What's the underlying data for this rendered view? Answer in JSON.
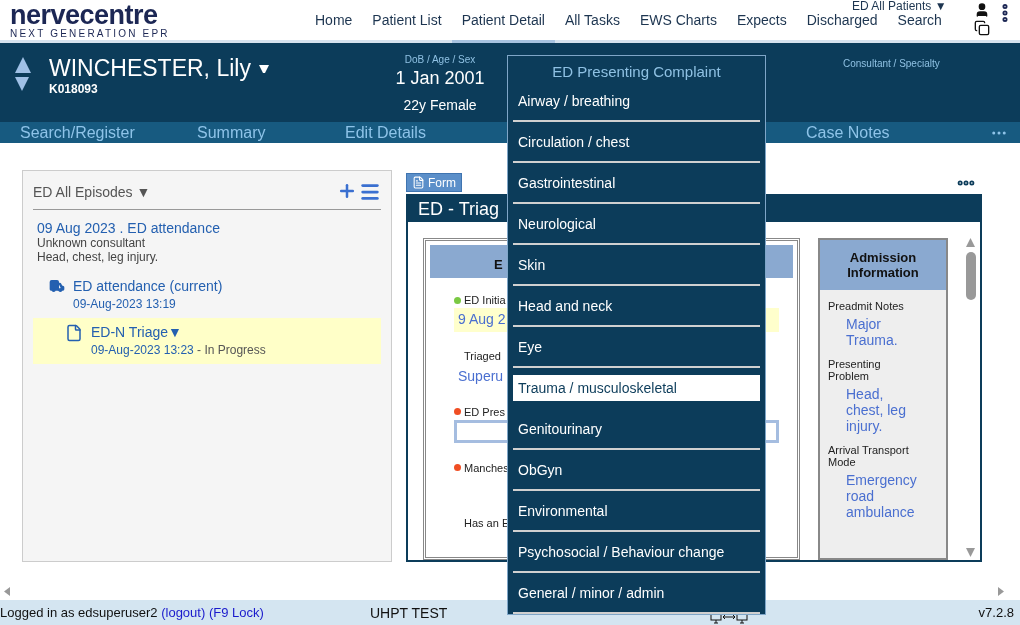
{
  "logo": {
    "name": "nervecentre",
    "tagline": "NEXT GENERATION EPR"
  },
  "nav": [
    {
      "label": "Home",
      "selected": false
    },
    {
      "label": "Patient List",
      "selected": false
    },
    {
      "label": "Patient Detail",
      "selected": true
    },
    {
      "label": "All Tasks",
      "selected": false
    },
    {
      "label": "EWS Charts",
      "selected": false
    },
    {
      "label": "Expects",
      "selected": false
    },
    {
      "label": "Discharged",
      "selected": false
    },
    {
      "label": "Search",
      "selected": false
    }
  ],
  "patient_list_selector": "ED All Patients ▼",
  "patient": {
    "name": "WINCHESTER, Lily",
    "id": "K018093",
    "dob_label": "DoB / Age / Sex",
    "dob": "1 Jan 2001",
    "age_sex": "22y Female",
    "consultant_label": "Consultant / Specialty"
  },
  "subnav": [
    "Search/Register",
    "Summary",
    "Edit Details",
    "Case Notes"
  ],
  "episodes": {
    "title": "ED All Episodes ▼",
    "episode": {
      "title": "09 Aug 2023 . ED attendance",
      "consultant": "Unknown consultant",
      "complaint": "Head, chest, leg injury.",
      "items": [
        {
          "kind": "attendance",
          "title": "ED attendance (current)",
          "time": "09-Aug-2023 13:19",
          "selected": false
        },
        {
          "kind": "form",
          "title": "ED-N Triage▼",
          "time": "09-Aug-2023 13:23",
          "status": " - In Progress",
          "selected": true
        }
      ]
    }
  },
  "form": {
    "button": "Form",
    "title": "ED - Triag",
    "section": "E",
    "fields": [
      {
        "kind": "date",
        "label": "ED Initia",
        "value": "9 Aug 2",
        "color": "#7ac943"
      },
      {
        "kind": "text",
        "label": "Triaged",
        "value": "Superu"
      },
      {
        "kind": "input",
        "label": "ED Pres",
        "color": "#f04e23"
      },
      {
        "kind": "plain",
        "label": "Manches",
        "color": "#f04e23"
      },
      {
        "kind": "plain",
        "label": "Has an E"
      }
    ],
    "admission": {
      "title": "Admission Information",
      "entries": [
        {
          "label": "Preadmit Notes",
          "value": "Major Trauma."
        },
        {
          "label": "Presenting Problem",
          "value": "Head, chest, leg injury."
        },
        {
          "label": "Arrival Transport Mode",
          "value": "Emergency road ambulance"
        }
      ]
    }
  },
  "dropdown": {
    "title": "ED Presenting Complaint",
    "options": [
      {
        "label": "Airway / breathing",
        "selected": false
      },
      {
        "label": "Circulation / chest",
        "selected": false
      },
      {
        "label": "Gastrointestinal",
        "selected": false
      },
      {
        "label": "Neurological",
        "selected": false
      },
      {
        "label": "Skin",
        "selected": false
      },
      {
        "label": "Head and neck",
        "selected": false
      },
      {
        "label": "Eye",
        "selected": false
      },
      {
        "label": "Trauma / musculoskeletal",
        "selected": true
      },
      {
        "label": "Genitourinary",
        "selected": false
      },
      {
        "label": "ObGyn",
        "selected": false
      },
      {
        "label": "Environmental",
        "selected": false
      },
      {
        "label": "Psychosocial / Behaviour change",
        "selected": false
      },
      {
        "label": "General / minor / admin",
        "selected": false
      }
    ]
  },
  "status_bar": {
    "user": "Logged in as edsuperuser2",
    "logout": "(logout)",
    "lock": "(F9 Lock)",
    "environment": "UHPT TEST",
    "version": "v7.2.8"
  }
}
